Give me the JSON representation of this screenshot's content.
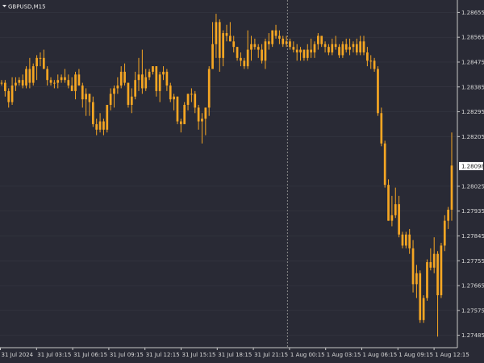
{
  "window": {
    "symbol": "GBPUSD,M15"
  },
  "colors": {
    "background": "#292a35",
    "grid": "#3a3b46",
    "axis": "#c8c8c8",
    "bull": "#f5a623",
    "bear": "#f5a623",
    "current_price_box": "#ffffff",
    "crosshair": "#8a8a8a"
  },
  "chart_data": {
    "type": "candlestick",
    "symbol": "GBPUSD",
    "timeframe": "M15",
    "ylim": [
      1.2744,
      1.287
    ],
    "y_ticks": [
      "1.28655",
      "1.28565",
      "1.28475",
      "1.28385",
      "1.28295",
      "1.28205",
      "1.28025",
      "1.27935",
      "1.27845",
      "1.27755",
      "1.27665",
      "1.27575",
      "1.27485"
    ],
    "x_ticks": [
      "31 Jul 2024",
      "31 Jul 03:15",
      "31 Jul 06:15",
      "31 Jul 09:15",
      "31 Jul 12:15",
      "31 Jul 15:15",
      "31 Jul 18:15",
      "31 Jul 21:15",
      "1 Aug 00:15",
      "1 Aug 03:15",
      "1 Aug 06:15",
      "1 Aug 09:15",
      "1 Aug 12:15"
    ],
    "current_price": "1.28098",
    "grid": true,
    "candles": [
      [
        1.284,
        1.2841,
        1.2839,
        1.284
      ],
      [
        1.284,
        1.2841,
        1.2835,
        1.2837
      ],
      [
        1.2837,
        1.2838,
        1.2831,
        1.2833
      ],
      [
        1.2833,
        1.2842,
        1.2832,
        1.2839
      ],
      [
        1.2839,
        1.2842,
        1.2837,
        1.284
      ],
      [
        1.284,
        1.2842,
        1.2839,
        1.2841
      ],
      [
        1.2841,
        1.2843,
        1.2838,
        1.2839
      ],
      [
        1.2839,
        1.2846,
        1.2838,
        1.2845
      ],
      [
        1.2845,
        1.2849,
        1.2838,
        1.284
      ],
      [
        1.284,
        1.2847,
        1.2839,
        1.2846
      ],
      [
        1.2846,
        1.285,
        1.2841,
        1.2849
      ],
      [
        1.2849,
        1.2851,
        1.2846,
        1.2849
      ],
      [
        1.2849,
        1.2852,
        1.2845,
        1.2845
      ],
      [
        1.2845,
        1.2846,
        1.2839,
        1.2841
      ],
      [
        1.2841,
        1.2842,
        1.2839,
        1.284
      ],
      [
        1.284,
        1.2841,
        1.2838,
        1.284
      ],
      [
        1.284,
        1.2843,
        1.2838,
        1.2841
      ],
      [
        1.2841,
        1.2843,
        1.284,
        1.2842
      ],
      [
        1.2842,
        1.2845,
        1.284,
        1.2841
      ],
      [
        1.2841,
        1.2843,
        1.2838,
        1.2839
      ],
      [
        1.2839,
        1.2842,
        1.2837,
        1.2837
      ],
      [
        1.2837,
        1.2844,
        1.2834,
        1.2843
      ],
      [
        1.2843,
        1.2845,
        1.2839,
        1.2839
      ],
      [
        1.2839,
        1.284,
        1.2831,
        1.2834
      ],
      [
        1.2834,
        1.2838,
        1.2828,
        1.2836
      ],
      [
        1.2836,
        1.2836,
        1.2828,
        1.2833
      ],
      [
        1.2833,
        1.2835,
        1.2824,
        1.2825
      ],
      [
        1.2825,
        1.2827,
        1.2821,
        1.2823
      ],
      [
        1.2823,
        1.2829,
        1.2822,
        1.2826
      ],
      [
        1.2826,
        1.2827,
        1.2821,
        1.2823
      ],
      [
        1.2823,
        1.2832,
        1.2822,
        1.2832
      ],
      [
        1.2832,
        1.2838,
        1.283,
        1.2836
      ],
      [
        1.2836,
        1.2839,
        1.2831,
        1.2838
      ],
      [
        1.2838,
        1.2842,
        1.2836,
        1.2839
      ],
      [
        1.2839,
        1.2846,
        1.2838,
        1.2844
      ],
      [
        1.2844,
        1.2847,
        1.2839,
        1.284
      ],
      [
        1.284,
        1.284,
        1.2831,
        1.2832
      ],
      [
        1.2832,
        1.2838,
        1.2829,
        1.2835
      ],
      [
        1.2835,
        1.2844,
        1.2834,
        1.2841
      ],
      [
        1.2841,
        1.2849,
        1.2837,
        1.2843
      ],
      [
        1.2843,
        1.2852,
        1.2836,
        1.2838
      ],
      [
        1.2838,
        1.2845,
        1.2837,
        1.2842
      ],
      [
        1.2842,
        1.2845,
        1.2841,
        1.2844
      ],
      [
        1.2844,
        1.2846,
        1.2843,
        1.2846
      ],
      [
        1.2846,
        1.2846,
        1.2835,
        1.2837
      ],
      [
        1.2837,
        1.2844,
        1.2833,
        1.2843
      ],
      [
        1.2843,
        1.2846,
        1.2841,
        1.2844
      ],
      [
        1.2844,
        1.2845,
        1.2837,
        1.2839
      ],
      [
        1.2839,
        1.284,
        1.2833,
        1.2834
      ],
      [
        1.2834,
        1.2836,
        1.283,
        1.2835
      ],
      [
        1.2835,
        1.2835,
        1.2825,
        1.2826
      ],
      [
        1.2826,
        1.2827,
        1.2822,
        1.2825
      ],
      [
        1.2825,
        1.2833,
        1.2825,
        1.2832
      ],
      [
        1.2832,
        1.2836,
        1.283,
        1.2836
      ],
      [
        1.2836,
        1.2838,
        1.2833,
        1.2836
      ],
      [
        1.2836,
        1.2837,
        1.2829,
        1.2831
      ],
      [
        1.2831,
        1.2832,
        1.2823,
        1.2826
      ],
      [
        1.2826,
        1.2829,
        1.2818,
        1.2827
      ],
      [
        1.2827,
        1.2831,
        1.2821,
        1.2831
      ],
      [
        1.2831,
        1.2846,
        1.2828,
        1.2845
      ],
      [
        1.2845,
        1.2862,
        1.2845,
        1.2854
      ],
      [
        1.2854,
        1.2865,
        1.2849,
        1.2862
      ],
      [
        1.2862,
        1.2863,
        1.2844,
        1.2849
      ],
      [
        1.2849,
        1.2859,
        1.2846,
        1.2858
      ],
      [
        1.2858,
        1.2861,
        1.2855,
        1.2857
      ],
      [
        1.2857,
        1.2862,
        1.2855,
        1.2855
      ],
      [
        1.2855,
        1.2857,
        1.2851,
        1.2853
      ],
      [
        1.2853,
        1.2853,
        1.2848,
        1.2849
      ],
      [
        1.2849,
        1.2851,
        1.2846,
        1.2848
      ],
      [
        1.2848,
        1.2849,
        1.2845,
        1.2846
      ],
      [
        1.2846,
        1.2859,
        1.2845,
        1.2852
      ],
      [
        1.2852,
        1.2857,
        1.2848,
        1.2854
      ],
      [
        1.2854,
        1.2856,
        1.2852,
        1.2853
      ],
      [
        1.2853,
        1.2854,
        1.2849,
        1.2852
      ],
      [
        1.2852,
        1.2854,
        1.2847,
        1.2848
      ],
      [
        1.2848,
        1.2856,
        1.2845,
        1.2855
      ],
      [
        1.2855,
        1.2858,
        1.2852,
        1.2854
      ],
      [
        1.2854,
        1.2859,
        1.2853,
        1.2859
      ],
      [
        1.2859,
        1.2861,
        1.2856,
        1.2857
      ],
      [
        1.2857,
        1.2859,
        1.2854,
        1.2856
      ],
      [
        1.2856,
        1.2857,
        1.2853,
        1.2854
      ],
      [
        1.2854,
        1.2857,
        1.2853,
        1.2855
      ],
      [
        1.2855,
        1.2856,
        1.2852,
        1.2853
      ],
      [
        1.2853,
        1.2855,
        1.2851,
        1.2852
      ],
      [
        1.2852,
        1.2854,
        1.2848,
        1.2851
      ],
      [
        1.2851,
        1.2853,
        1.2848,
        1.2852
      ],
      [
        1.2852,
        1.2852,
        1.2848,
        1.2849
      ],
      [
        1.2849,
        1.2854,
        1.2848,
        1.2852
      ],
      [
        1.2852,
        1.2856,
        1.2849,
        1.2851
      ],
      [
        1.2851,
        1.2855,
        1.2849,
        1.2854
      ],
      [
        1.2854,
        1.2858,
        1.2852,
        1.2857
      ],
      [
        1.2857,
        1.2857,
        1.2853,
        1.2854
      ],
      [
        1.2854,
        1.2855,
        1.2851,
        1.2853
      ],
      [
        1.2853,
        1.2854,
        1.285,
        1.2851
      ],
      [
        1.2851,
        1.2856,
        1.285,
        1.2854
      ],
      [
        1.2854,
        1.2857,
        1.2852,
        1.2853
      ],
      [
        1.2853,
        1.2854,
        1.2849,
        1.285
      ],
      [
        1.285,
        1.2855,
        1.2849,
        1.2854
      ],
      [
        1.2854,
        1.2856,
        1.2851,
        1.2852
      ],
      [
        1.2852,
        1.2856,
        1.285,
        1.2853
      ],
      [
        1.2853,
        1.2855,
        1.2851,
        1.2854
      ],
      [
        1.2854,
        1.2856,
        1.285,
        1.2851
      ],
      [
        1.2851,
        1.2857,
        1.285,
        1.2855
      ],
      [
        1.2855,
        1.2857,
        1.285,
        1.2851
      ],
      [
        1.2851,
        1.2853,
        1.2846,
        1.2848
      ],
      [
        1.2848,
        1.285,
        1.2845,
        1.2848
      ],
      [
        1.2848,
        1.2849,
        1.2844,
        1.2845
      ],
      [
        1.2845,
        1.2846,
        1.2828,
        1.2829
      ],
      [
        1.2829,
        1.2831,
        1.2817,
        1.2818
      ],
      [
        1.2818,
        1.2819,
        1.2802,
        1.2803
      ],
      [
        1.2803,
        1.2805,
        1.279,
        1.279
      ],
      [
        1.279,
        1.2799,
        1.2788,
        1.2792
      ],
      [
        1.2792,
        1.2802,
        1.2791,
        1.2796
      ],
      [
        1.2796,
        1.2799,
        1.2784,
        1.2785
      ],
      [
        1.2785,
        1.2786,
        1.278,
        1.2781
      ],
      [
        1.2781,
        1.2786,
        1.278,
        1.2785
      ],
      [
        1.2785,
        1.2787,
        1.2778,
        1.278
      ],
      [
        1.278,
        1.2783,
        1.2764,
        1.2767
      ],
      [
        1.2767,
        1.2774,
        1.2762,
        1.2771
      ],
      [
        1.2771,
        1.2772,
        1.2753,
        1.2754
      ],
      [
        1.2754,
        1.2763,
        1.2753,
        1.2762
      ],
      [
        1.2762,
        1.2776,
        1.2761,
        1.2775
      ],
      [
        1.2775,
        1.278,
        1.2772,
        1.2773
      ],
      [
        1.2773,
        1.2784,
        1.2771,
        1.2778
      ],
      [
        1.2778,
        1.2779,
        1.2748,
        1.2763
      ],
      [
        1.2763,
        1.2782,
        1.2762,
        1.2781
      ],
      [
        1.2781,
        1.2792,
        1.2779,
        1.279
      ],
      [
        1.279,
        1.2795,
        1.2787,
        1.2794
      ],
      [
        1.2794,
        1.2822,
        1.279,
        1.281
      ]
    ]
  }
}
